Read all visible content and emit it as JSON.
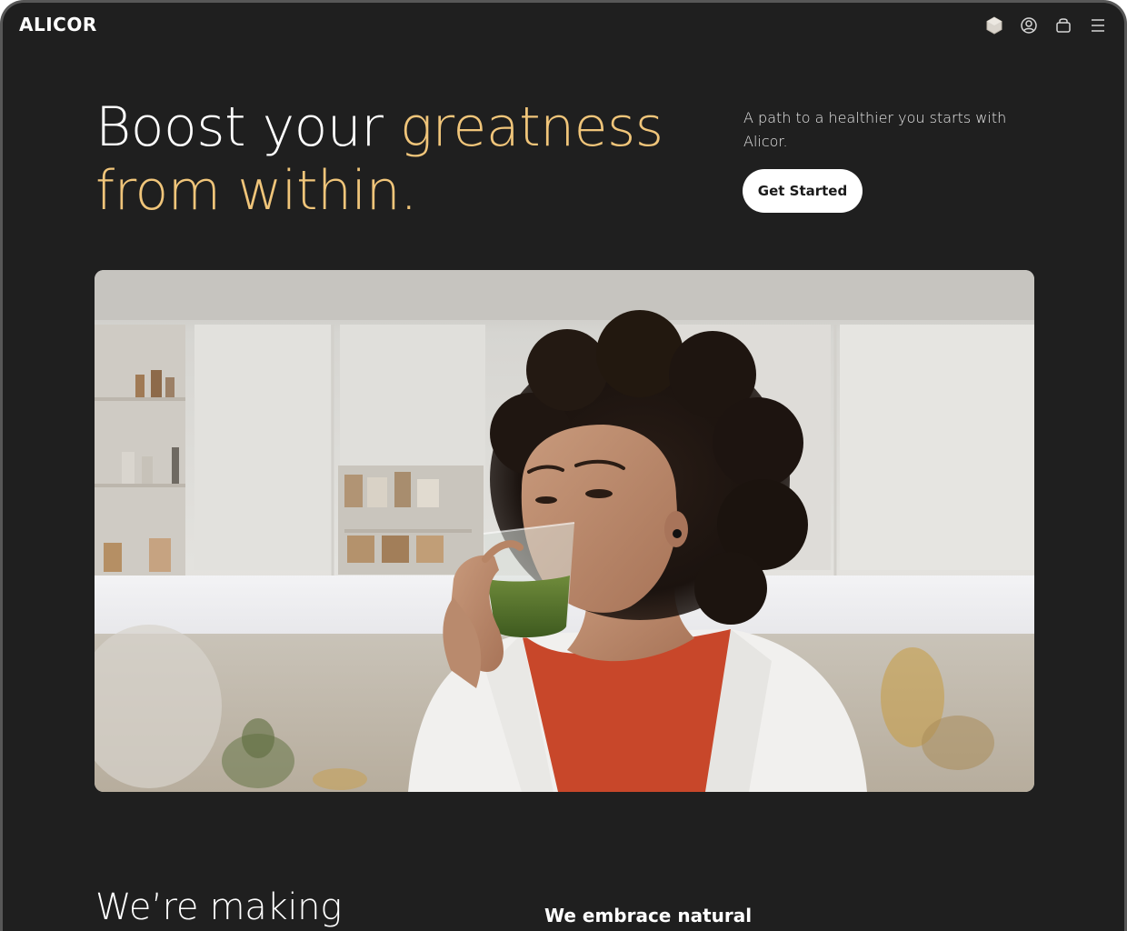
{
  "header": {
    "logo": "ALICOR",
    "icons": [
      "hexagon-icon",
      "user-icon",
      "cart-icon",
      "menu-icon"
    ]
  },
  "hero": {
    "headline_line1_plain": "Boost your ",
    "headline_line1_accent": "greatness",
    "headline_line2_accent": "from within.",
    "tagline": "A path to a healthier you starts with Alicor.",
    "cta_label": "Get Started",
    "image_description": "woman-drinking-green-juice"
  },
  "section": {
    "title": "We’re making",
    "subtitle": "We embrace natural"
  },
  "colors": {
    "background": "#1f1f1f",
    "accent": "#f0c57a",
    "text": "#ffffff",
    "button_bg": "#ffffff"
  }
}
